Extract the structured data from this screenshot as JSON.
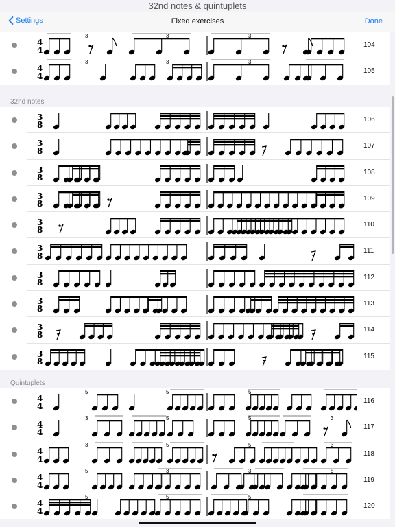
{
  "status_title": "32nd notes & quintuplets",
  "nav": {
    "back_label": "Settings",
    "title": "Fixed exercises",
    "done_label": "Done"
  },
  "sections": [
    {
      "header": "",
      "rows": [
        {
          "number": "104",
          "time_signature": [
            "4",
            "4"
          ],
          "tuplet_labels": [
            "3",
            "3",
            "3"
          ]
        },
        {
          "number": "105",
          "time_signature": [
            "4",
            "4"
          ],
          "tuplet_labels": [
            "3",
            "3",
            "3"
          ]
        }
      ]
    },
    {
      "header": "32nd notes",
      "rows": [
        {
          "number": "106",
          "time_signature": [
            "3",
            "8"
          ],
          "tuplet_labels": []
        },
        {
          "number": "107",
          "time_signature": [
            "3",
            "8"
          ],
          "tuplet_labels": []
        },
        {
          "number": "108",
          "time_signature": [
            "3",
            "8"
          ],
          "tuplet_labels": []
        },
        {
          "number": "109",
          "time_signature": [
            "3",
            "8"
          ],
          "tuplet_labels": []
        },
        {
          "number": "110",
          "time_signature": [
            "3",
            "8"
          ],
          "tuplet_labels": []
        },
        {
          "number": "111",
          "time_signature": [
            "3",
            "8"
          ],
          "tuplet_labels": []
        },
        {
          "number": "112",
          "time_signature": [
            "3",
            "8"
          ],
          "tuplet_labels": []
        },
        {
          "number": "113",
          "time_signature": [
            "3",
            "8"
          ],
          "tuplet_labels": []
        },
        {
          "number": "114",
          "time_signature": [
            "3",
            "8"
          ],
          "tuplet_labels": []
        },
        {
          "number": "115",
          "time_signature": [
            "3",
            "8"
          ],
          "tuplet_labels": []
        }
      ]
    },
    {
      "header": "Quintuplets",
      "rows": [
        {
          "number": "116",
          "time_signature": [
            "4",
            "4"
          ],
          "tuplet_labels": [
            "5",
            "5",
            "5"
          ]
        },
        {
          "number": "117",
          "time_signature": [
            "4",
            "4"
          ],
          "tuplet_labels": [
            "3",
            "5",
            "5",
            "3"
          ]
        },
        {
          "number": "118",
          "time_signature": [
            "4",
            "4"
          ],
          "tuplet_labels": [
            "3",
            "5",
            "5",
            "3"
          ]
        },
        {
          "number": "119",
          "time_signature": [
            "4",
            "4"
          ],
          "tuplet_labels": [
            "5",
            "3",
            "3",
            "5"
          ]
        },
        {
          "number": "120",
          "time_signature": [
            "4",
            "4"
          ],
          "tuplet_labels": [
            "5",
            "5",
            "5"
          ]
        }
      ]
    }
  ]
}
